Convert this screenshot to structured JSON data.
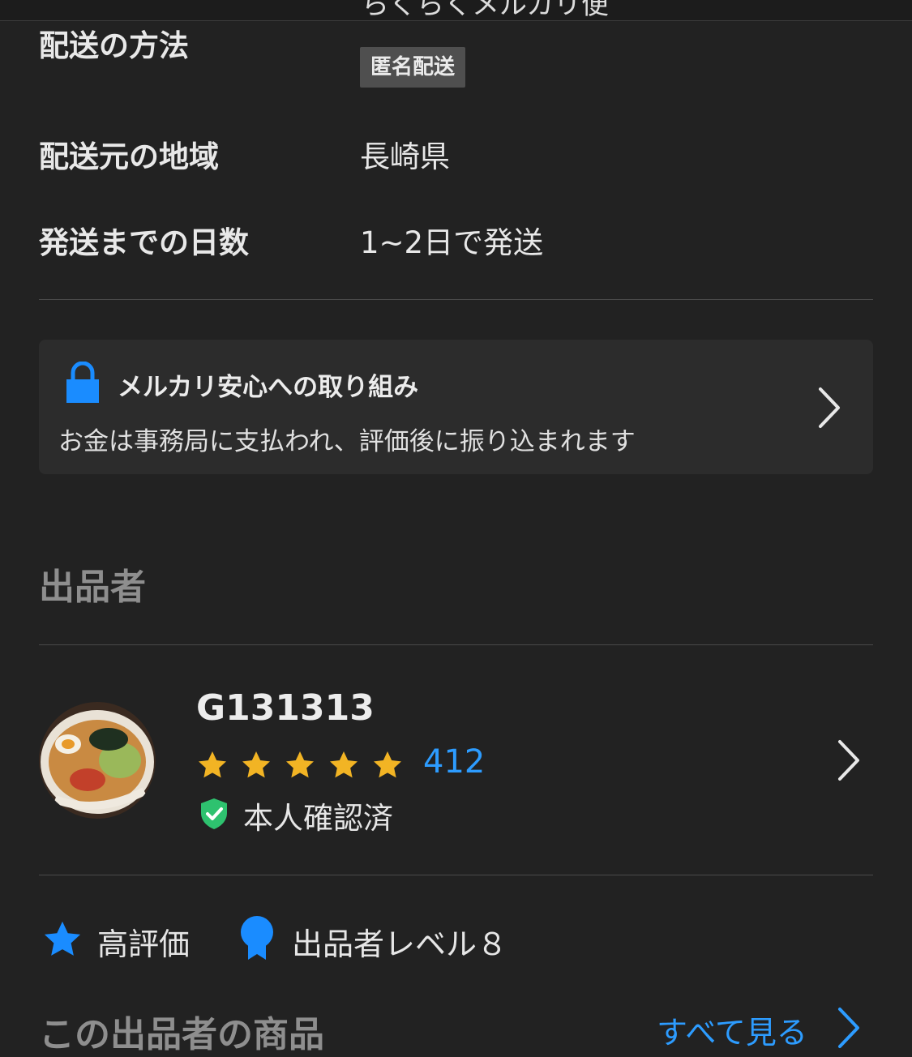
{
  "header": {
    "cutoff_text": "らくらくメルカリ便"
  },
  "shipping": {
    "method_label": "配送の方法",
    "method_badge": "匿名配送",
    "origin_label": "配送元の地域",
    "origin_value": "長崎県",
    "days_label": "発送までの日数",
    "days_value": "1~2日で発送"
  },
  "safety": {
    "title": "メルカリ安心への取り組み",
    "description": "お金は事務局に支払われ、評価後に振り込まれます",
    "icon": "lock-icon"
  },
  "seller_section": {
    "heading": "出品者",
    "name": "G131313",
    "rating_stars": 5,
    "rating_count": "412",
    "verified_label": "本人確認済",
    "badges": [
      {
        "icon": "star-icon",
        "label": "高評価"
      },
      {
        "icon": "medal-icon",
        "label": "出品者レベル８"
      }
    ]
  },
  "products_section": {
    "heading": "この出品者の商品",
    "see_all": "すべて見る"
  },
  "colors": {
    "background": "#222222",
    "card": "#2c2c2c",
    "accent_blue": "#2d9cff",
    "lock_blue": "#1a8cff",
    "star_gold": "#f2b424",
    "verified_green": "#2ec26f"
  }
}
